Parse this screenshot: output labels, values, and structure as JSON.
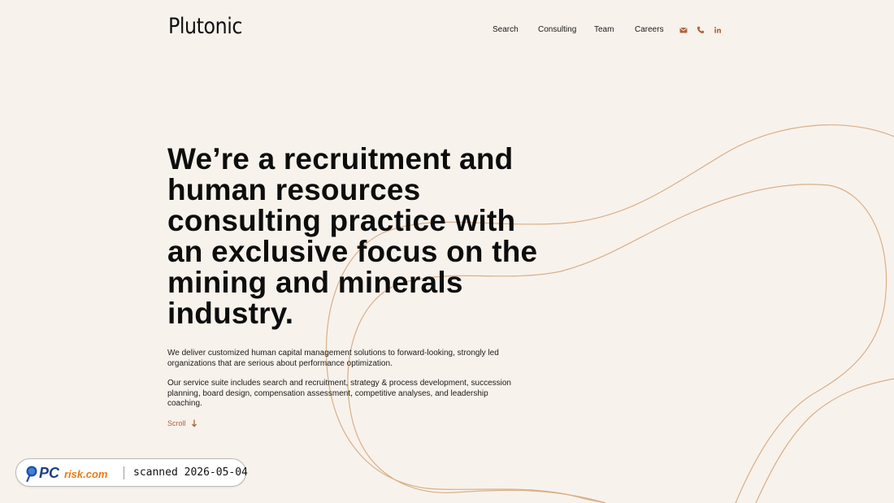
{
  "brand": {
    "logo_text": "Plutonic"
  },
  "nav": {
    "items": [
      {
        "label": "Search"
      },
      {
        "label": "Consulting"
      },
      {
        "label": "Team"
      },
      {
        "label": "Careers"
      }
    ],
    "contact_icons": [
      "envelope-icon",
      "phone-icon",
      "linkedin-icon"
    ]
  },
  "hero": {
    "title": "We’re a recruitment and human resources consulting practice with an exclusive focus on the mining and minerals industry.",
    "paragraphs": [
      "We deliver customized human capital management solutions to forward-looking, strongly led organizations that are serious about performance optimization.",
      "Our service suite includes search and recruitment, strategy & process development, succession planning, board design, compensation assessment, competitive analyses, and leadership coaching."
    ],
    "scroll_label": "Scroll",
    "scroll_icon": "arrow-down-icon"
  },
  "watermark": {
    "logo_text": "PCrisk.com",
    "scan_text": "scanned 2026-05-04"
  },
  "colors": {
    "background": "#f8f2ec",
    "accent": "#b0623c",
    "decorative_line": "#d7b08a",
    "text": "#111111"
  }
}
